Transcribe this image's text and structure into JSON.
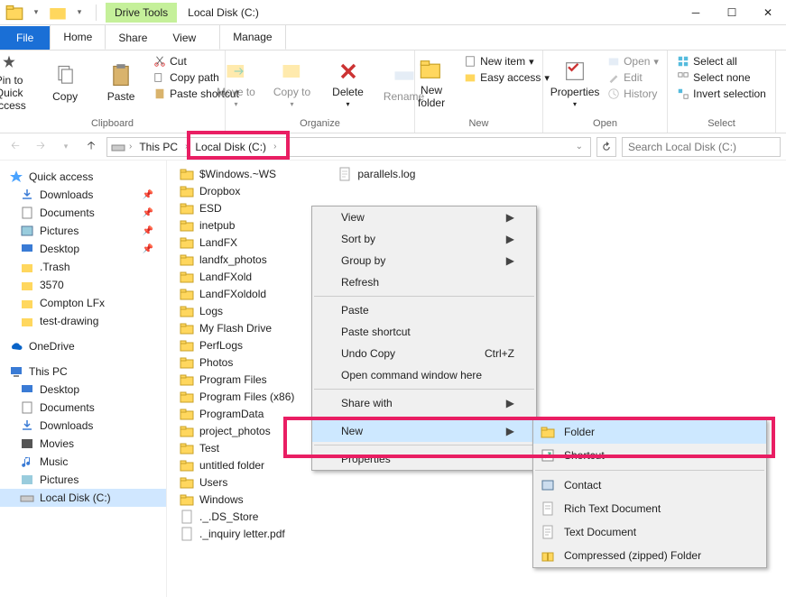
{
  "window": {
    "title": "Local Disk (C:)",
    "drivetools": "Drive Tools"
  },
  "tabs": {
    "file": "File",
    "items": [
      "Home",
      "Share",
      "View"
    ],
    "manage": "Manage"
  },
  "ribbon": {
    "clipboard": {
      "label": "Clipboard",
      "pin": "Pin to Quick access",
      "copy": "Copy",
      "paste": "Paste",
      "cut": "Cut",
      "copypath": "Copy path",
      "pasteshort": "Paste shortcut"
    },
    "organize": {
      "label": "Organize",
      "moveto": "Move to",
      "copyto": "Copy to",
      "delete": "Delete",
      "rename": "Rename"
    },
    "new": {
      "label": "New",
      "newfolder": "New folder",
      "newitem": "New item",
      "easyaccess": "Easy access"
    },
    "open": {
      "label": "Open",
      "properties": "Properties",
      "open": "Open",
      "edit": "Edit",
      "history": "History"
    },
    "select": {
      "label": "Select",
      "all": "Select all",
      "none": "Select none",
      "invert": "Invert selection"
    }
  },
  "breadcrumb": {
    "thispc": "This PC",
    "drive": "Local Disk (C:)"
  },
  "search": {
    "placeholder": "Search Local Disk (C:)"
  },
  "nav": {
    "quickaccess": "Quick access",
    "qa": [
      "Downloads",
      "Documents",
      "Pictures",
      "Desktop",
      ".Trash",
      "3570",
      "Compton LFx",
      "test-drawing"
    ],
    "onedrive": "OneDrive",
    "thispc": "This PC",
    "pc": [
      "Desktop",
      "Documents",
      "Downloads",
      "Movies",
      "Music",
      "Pictures",
      "Local Disk (C:)"
    ]
  },
  "folders": [
    "$Windows.~WS",
    "Dropbox",
    "ESD",
    "inetpub",
    "LandFX",
    "landfx_photos",
    "LandFXold",
    "LandFXoldold",
    "Logs",
    "My Flash Drive",
    "PerfLogs",
    "Photos",
    "Program Files",
    "Program Files (x86)",
    "ProgramData",
    "project_photos",
    "Test",
    "untitled folder",
    "Users",
    "Windows",
    "._.DS_Store",
    "._inquiry letter.pdf"
  ],
  "files": [
    "parallels.log"
  ],
  "ctx": {
    "view": "View",
    "sortby": "Sort by",
    "groupby": "Group by",
    "refresh": "Refresh",
    "paste": "Paste",
    "pasteshort": "Paste shortcut",
    "undo": "Undo Copy",
    "undokey": "Ctrl+Z",
    "opencmd": "Open command window here",
    "sharewith": "Share with",
    "new": "New",
    "properties": "Properties"
  },
  "submenu": {
    "folder": "Folder",
    "shortcut": "Shortcut",
    "contact": "Contact",
    "rtf": "Rich Text Document",
    "txt": "Text Document",
    "zip": "Compressed (zipped) Folder"
  }
}
